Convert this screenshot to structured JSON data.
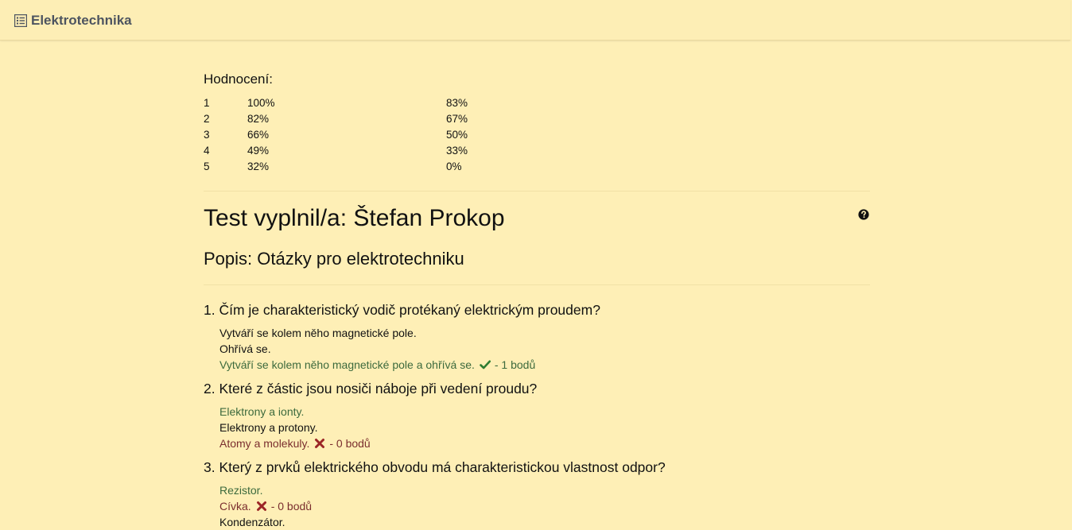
{
  "navbar": {
    "brand_icon": "list-icon",
    "brand": "Elektrotechnika"
  },
  "grading": {
    "title": "Hodnocení:",
    "rows": [
      {
        "grade": "1",
        "a": "100%",
        "b": "83%"
      },
      {
        "grade": "2",
        "a": "82%",
        "b": "67%"
      },
      {
        "grade": "3",
        "a": "66%",
        "b": "50%"
      },
      {
        "grade": "4",
        "a": "49%",
        "b": "33%"
      },
      {
        "grade": "5",
        "a": "32%",
        "b": "0%"
      }
    ]
  },
  "test": {
    "title": "Test vyplnil/a: Štefan Prokop",
    "help_icon": "question-circle-icon",
    "description": "Popis: Otázky pro elektrotechniku"
  },
  "questions": [
    {
      "title": "1. Čím je charakteristický vodič protékaný elektrickým proudem?",
      "answers": [
        {
          "text": "Vytváří se kolem něho magnetické pole.",
          "state": "plain"
        },
        {
          "text": "Ohřívá se.",
          "state": "plain"
        },
        {
          "text": "Vytváří se kolem něho magnetické pole a ohřívá se.",
          "state": "correct",
          "icon": "check-icon",
          "points": "- 1 bodů"
        }
      ]
    },
    {
      "title": "2. Které z částic jsou nosiči náboje při vedení proudu?",
      "answers": [
        {
          "text": "Elektrony a ionty.",
          "state": "correct"
        },
        {
          "text": "Elektrony a protony.",
          "state": "plain"
        },
        {
          "text": "Atomy a molekuly.",
          "state": "wrong",
          "icon": "cross-icon",
          "points": "- 0 bodů"
        }
      ]
    },
    {
      "title": "3. Který z prvků elektrického obvodu má charakteristickou vlastnost odpor?",
      "answers": [
        {
          "text": "Rezistor.",
          "state": "correct"
        },
        {
          "text": "Cívka.",
          "state": "wrong",
          "icon": "cross-icon",
          "points": "- 0 bodů"
        },
        {
          "text": "Kondenzátor.",
          "state": "plain"
        }
      ]
    }
  ],
  "colors": {
    "background": "#feefb6",
    "correct": "#3c6a3d",
    "wrong": "#7a2e2e",
    "check": "#2f7d32",
    "cross": "#9b2626"
  }
}
